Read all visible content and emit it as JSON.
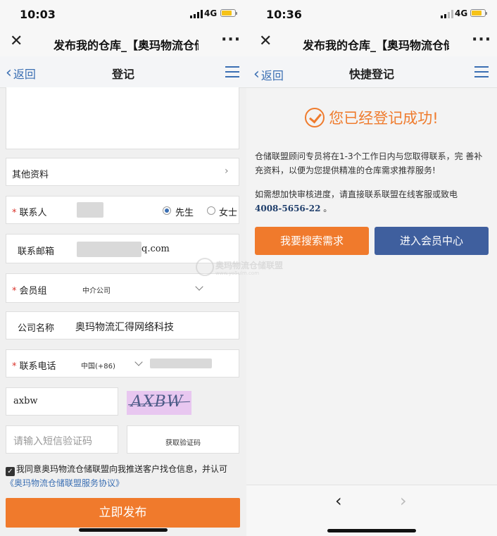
{
  "left": {
    "status": {
      "time": "10:03",
      "network": "4G"
    },
    "wechat": {
      "title": "发布我的仓库_【奥玛物流仓储",
      "more": "···"
    },
    "header": {
      "back": "返回",
      "title": "登记"
    },
    "form": {
      "other_info": "其他资料",
      "contact_label": "联系人",
      "gender_male": "先生",
      "gender_female": "女士",
      "email_label": "联系邮箱",
      "email_suffix": "q.com",
      "member_group_label": "会员组",
      "member_group_value": "中介公司",
      "company_label": "公司名称",
      "company_value": "奥玛物流汇得网络科技",
      "phone_label": "联系电话",
      "phone_region": "中国(+86)",
      "captcha_input": "axbw",
      "captcha_image_text": "AXBW",
      "sms_placeholder": "请输入短信验证码",
      "sms_button": "获取验证码",
      "agree_text": "我同意奥玛物流仓储联盟向我推送客户找仓信息，并认可",
      "agree_link": "《奥玛物流仓储联盟服务协议》",
      "publish_button": "立即发布"
    }
  },
  "right": {
    "status": {
      "time": "10:36",
      "network": "4G"
    },
    "wechat": {
      "title": "发布我的仓库_【奥玛物流仓储",
      "more": "···"
    },
    "header": {
      "back": "返回",
      "title": "快捷登记"
    },
    "success_text": "您已经登记成功!",
    "para1": "仓储联盟顾问专员将在1-3个工作日内与您取得联系，完 善补充资料，以便为您提供精准的仓库需求推荐服务!",
    "para2": "如需想加快审核进度，请直接联系联盟在线客服或致电",
    "hotline": "4008-5656-22",
    "hotline_suffix": "。",
    "btn_search": "我要搜索需求",
    "btn_member": "进入会员中心",
    "nav_back": "‹",
    "nav_forward": "›"
  },
  "watermark": {
    "text": "奥玛物流仓储联盟",
    "url": "www.yo5ulm.com"
  },
  "colors": {
    "orange": "#f07a2c",
    "blue": "#3f5f9e",
    "link": "#3b6fb3",
    "required": "#d9322a"
  }
}
